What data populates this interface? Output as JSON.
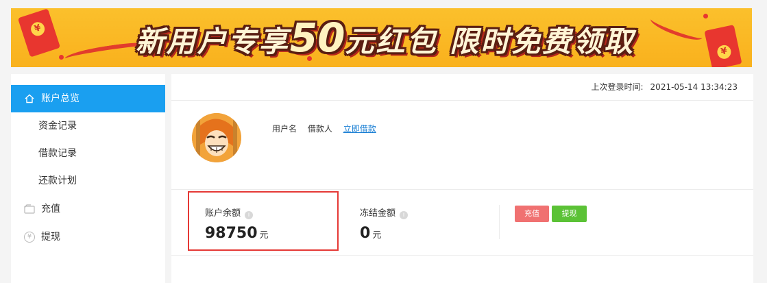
{
  "banner": {
    "title_prefix": "新用户专享",
    "title_amount": "50",
    "title_suffix": "元红包",
    "title_tail": "限时免费领取",
    "coin_symbol": "¥",
    "colors": {
      "background": "#f9b11d",
      "envelope": "#e8362f",
      "text": "#fff5d6"
    }
  },
  "sidebar": {
    "items": [
      {
        "label": "账户总览",
        "icon": "home-icon",
        "active": true
      },
      {
        "label": "资金记录"
      },
      {
        "label": "借款记录"
      },
      {
        "label": "还款计划"
      },
      {
        "label": "充值",
        "icon": "wallet-icon"
      },
      {
        "label": "提现",
        "icon": "yen-icon",
        "icon_glyph": "¥"
      }
    ],
    "active_color": "#1a9ff0"
  },
  "main": {
    "last_login_label": "上次登录时间:",
    "last_login_value": "2021-05-14 13:34:23",
    "user": {
      "username_label": "用户名",
      "username_value": "借款人",
      "borrow_link": "立即借款"
    },
    "balance": {
      "label": "账户余额",
      "value": "98750",
      "unit": "元",
      "info_glyph": "i"
    },
    "frozen": {
      "label": "冻结金额",
      "value": "0",
      "unit": "元",
      "info_glyph": "i"
    },
    "buttons": {
      "recharge": "充值",
      "withdraw": "提现"
    },
    "colors": {
      "highlight": "#e53935",
      "recharge": "#f07171",
      "withdraw": "#5bc236",
      "link": "#1a7fd4"
    }
  }
}
